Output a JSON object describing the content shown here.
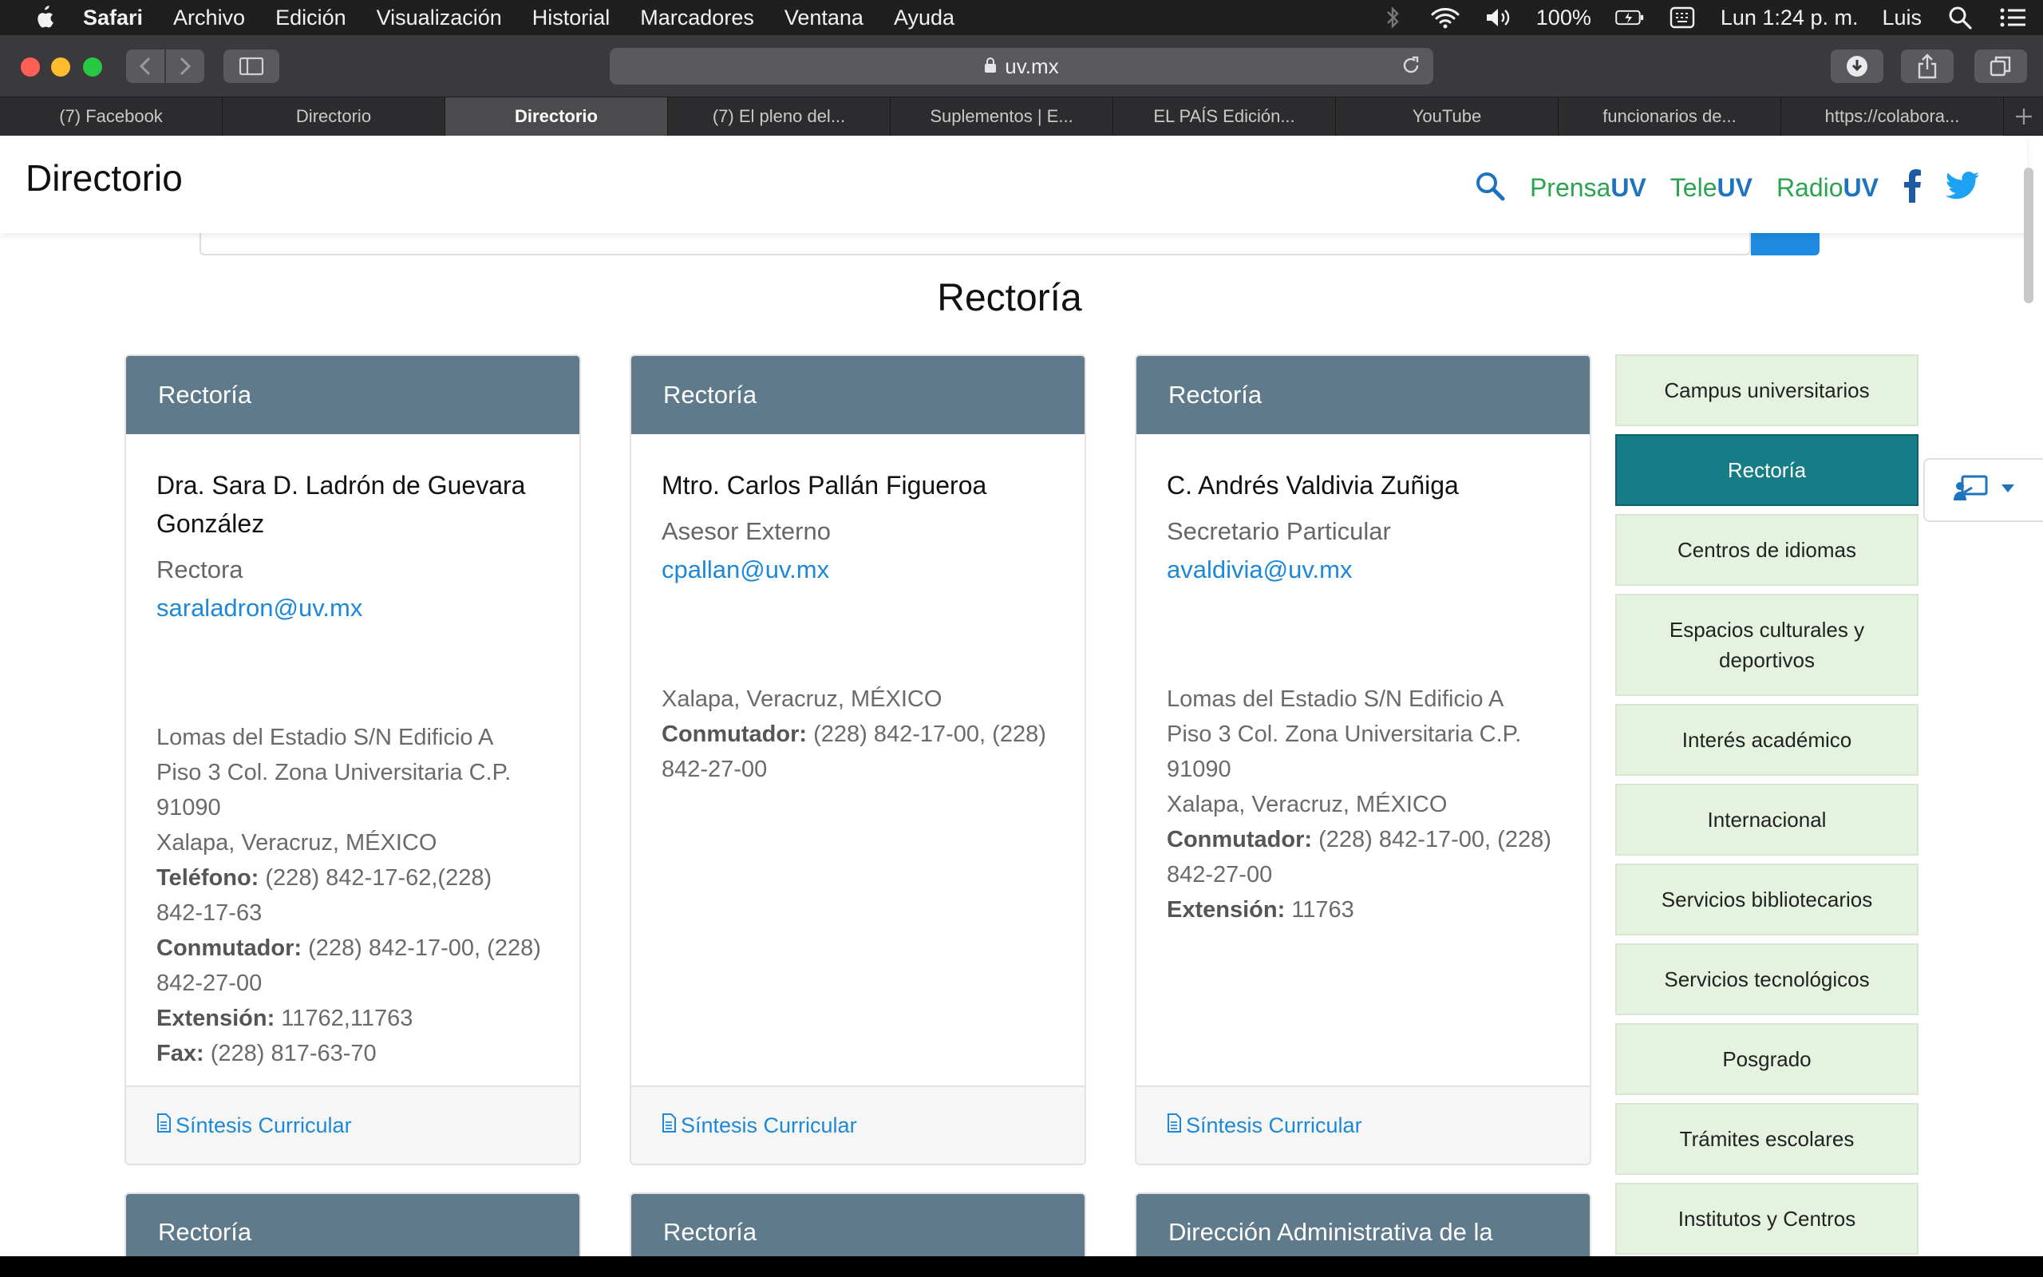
{
  "menubar": {
    "app": "Safari",
    "items": [
      "Archivo",
      "Edición",
      "Visualización",
      "Historial",
      "Marcadores",
      "Ventana",
      "Ayuda"
    ],
    "battery": "100%",
    "clock": "Lun 1:24 p. m.",
    "user": "Luis"
  },
  "browser": {
    "url": "uv.mx",
    "tabs": [
      {
        "label": "(7) Facebook",
        "active": false
      },
      {
        "label": "Directorio",
        "active": false
      },
      {
        "label": "Directorio",
        "active": true
      },
      {
        "label": "(7) El pleno del...",
        "active": false
      },
      {
        "label": "Suplementos | E...",
        "active": false
      },
      {
        "label": "EL PAÍS Edición...",
        "active": false
      },
      {
        "label": "YouTube",
        "active": false
      },
      {
        "label": "funcionarios de...",
        "active": false
      },
      {
        "label": "https://colabora...",
        "active": false
      }
    ]
  },
  "site": {
    "title": "Directorio",
    "brands": {
      "prensa_a": "Prensa",
      "prensa_b": "UV",
      "tele_a": "Tele",
      "tele_b": "UV",
      "radio_a": "Radio",
      "radio_b": "UV"
    },
    "section_title": "Rectoría"
  },
  "cards": [
    {
      "header": "Rectoría",
      "name_line1": "Dra. Sara D. Ladrón de Guevara",
      "name_line2": "González",
      "role": "Rectora",
      "email": "saraladron@uv.mx",
      "addr1": "Lomas del Estadio S/N Edificio A",
      "addr2": "Piso 3 Col. Zona Universitaria C.P.",
      "addr3": "91090",
      "city": "Xalapa, Veracruz, MÉXICO",
      "tel_label": "Teléfono:",
      "tel1": " (228) 842-17-62,(228)",
      "tel2": "842-17-63",
      "conm_label": "Conmutador:",
      "conm1": " (228) 842-17-00, (228)",
      "conm2": "842-27-00",
      "ext_label": "Extensión:",
      "ext": " 11762,11763",
      "fax_label": "Fax:",
      "fax": " (228) 817-63-70",
      "cv": "Síntesis Curricular"
    },
    {
      "header": "Rectoría",
      "name_line1": "Mtro. Carlos Pallán Figueroa",
      "role": "Asesor Externo",
      "email": "cpallan@uv.mx",
      "city": "Xalapa, Veracruz, MÉXICO",
      "conm_label": "Conmutador:",
      "conm1": " (228) 842-17-00, (228)",
      "conm2": "842-27-00",
      "cv": "Síntesis Curricular"
    },
    {
      "header": "Rectoría",
      "name_line1": "C. Andrés Valdivia Zuñiga",
      "role": "Secretario Particular",
      "email": "avaldivia@uv.mx",
      "addr1": "Lomas del Estadio S/N Edificio A",
      "addr2": "Piso 3 Col. Zona Universitaria C.P.",
      "addr3": "91090",
      "city": "Xalapa, Veracruz, MÉXICO",
      "conm_label": "Conmutador:",
      "conm1": " (228) 842-17-00, (228)",
      "conm2": "842-27-00",
      "ext_label": "Extensión:",
      "ext": " 11763",
      "cv": "Síntesis Curricular"
    }
  ],
  "next_cards": [
    "Rectoría",
    "Rectoría",
    "Dirección Administrativa de la"
  ],
  "side_menu": [
    {
      "label": "Campus universitarios",
      "active": false
    },
    {
      "label": "Rectoría",
      "active": true
    },
    {
      "label": "Centros de idiomas",
      "active": false
    },
    {
      "label": "Espacios culturales y deportivos",
      "active": false
    },
    {
      "label": "Interés académico",
      "active": false
    },
    {
      "label": "Internacional",
      "active": false
    },
    {
      "label": "Servicios bibliotecarios",
      "active": false
    },
    {
      "label": "Servicios tecnológicos",
      "active": false
    },
    {
      "label": "Posgrado",
      "active": false
    },
    {
      "label": "Trámites escolares",
      "active": false
    },
    {
      "label": "Institutos y Centros",
      "active": false
    }
  ],
  "colors": {
    "card_header": "#5f7a8a",
    "side_active": "#167d86",
    "side_bg": "#e6f2e0",
    "link": "#1e88d8"
  }
}
